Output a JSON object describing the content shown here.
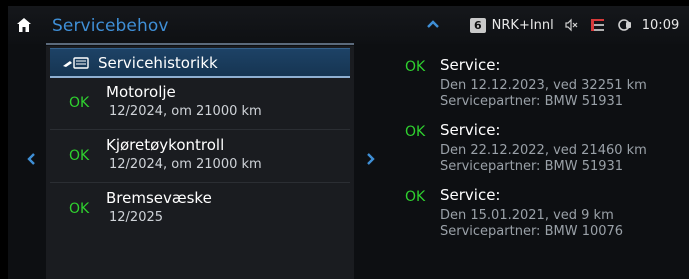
{
  "header": {
    "title": "Servicebehov",
    "radio_preset": "6",
    "radio_station": "NRK+Innl",
    "clock": "10:09",
    "home_icon": "home-icon",
    "up_icon": "chevron-up-icon",
    "status_icons": [
      "speaker-muted-icon",
      "fuel-icon",
      "connected-drive-icon"
    ]
  },
  "left": {
    "history_button": "Servicehistorikk",
    "history_icon": "service-history-icon",
    "items": [
      {
        "status": "OK",
        "name": "Motorolje",
        "detail": "12/2024, om 21000 km"
      },
      {
        "status": "OK",
        "name": "Kjøretøykontroll",
        "detail": "12/2024, om 21000 km"
      },
      {
        "status": "OK",
        "name": "Bremsevæske",
        "detail": "12/2025"
      }
    ]
  },
  "nav": {
    "left_icon": "chevron-left-icon",
    "right_icon": "chevron-right-icon"
  },
  "history": [
    {
      "status": "OK",
      "title": "Service:",
      "line1": "Den 12.12.2023, ved 32251 km",
      "line2": "Servicepartner: BMW 51931"
    },
    {
      "status": "OK",
      "title": "Service:",
      "line1": "Den 22.12.2022, ved 21460 km",
      "line2": "Servicepartner: BMW 51931"
    },
    {
      "status": "OK",
      "title": "Service:",
      "line1": "Den 15.01.2021, ved 9 km",
      "line2": "Servicepartner: BMW 10076"
    }
  ],
  "colors": {
    "accent": "#3f8fd6",
    "ok_green": "#2fd12f",
    "selected_bg": "#1d4266"
  }
}
